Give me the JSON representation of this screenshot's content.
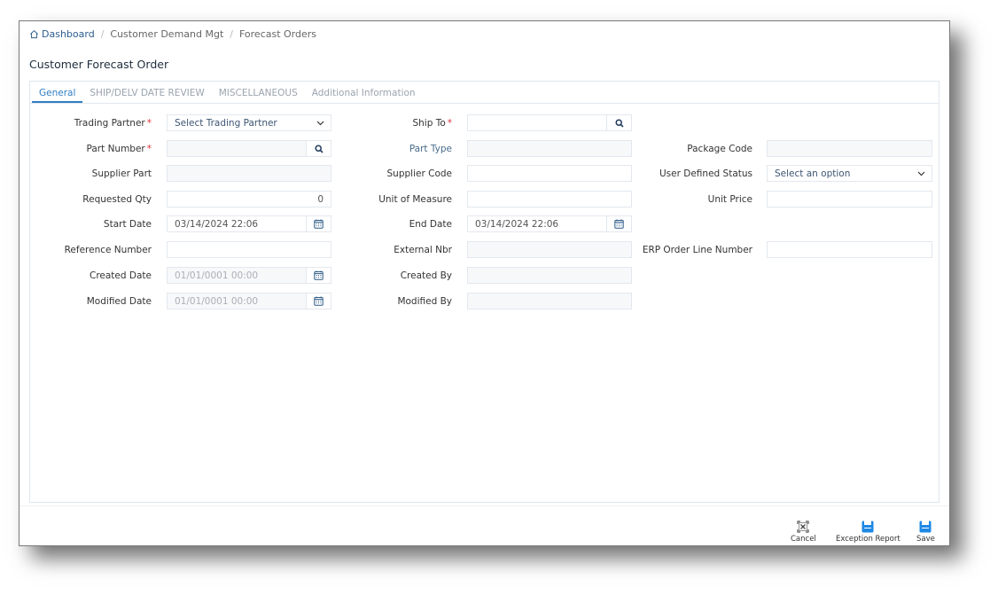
{
  "breadcrumb": {
    "items": [
      "Dashboard",
      "Customer Demand Mgt",
      "Forecast Orders"
    ]
  },
  "page": {
    "title": "Customer Forecast Order"
  },
  "tabs": [
    {
      "label": "General",
      "active": true
    },
    {
      "label": "SHIP/DELV DATE REVIEW",
      "active": false
    },
    {
      "label": "MISCELLANEOUS",
      "active": false
    },
    {
      "label": "Additional Information",
      "active": false
    }
  ],
  "form": {
    "trading_partner": {
      "label": "Trading Partner",
      "required": "*",
      "value": "Select Trading Partner"
    },
    "ship_to": {
      "label": "Ship To",
      "required": "*",
      "value": ""
    },
    "part_number": {
      "label": "Part Number",
      "required": "*",
      "value": ""
    },
    "part_type": {
      "label": "Part Type",
      "value": ""
    },
    "package_code": {
      "label": "Package Code",
      "value": ""
    },
    "supplier_part": {
      "label": "Supplier Part",
      "value": ""
    },
    "supplier_code": {
      "label": "Supplier Code",
      "value": ""
    },
    "user_defined_status": {
      "label": "User Defined Status",
      "value": "Select an option"
    },
    "requested_qty": {
      "label": "Requested Qty",
      "value": "0"
    },
    "unit_of_measure": {
      "label": "Unit of Measure",
      "value": ""
    },
    "unit_price": {
      "label": "Unit Price",
      "value": ""
    },
    "start_date": {
      "label": "Start Date",
      "value": "03/14/2024 22:06"
    },
    "end_date": {
      "label": "End Date",
      "value": "03/14/2024 22:06"
    },
    "reference_number": {
      "label": "Reference Number",
      "value": ""
    },
    "external_nbr": {
      "label": "External Nbr",
      "value": ""
    },
    "erp_order_line_number": {
      "label": "ERP Order Line Number",
      "value": ""
    },
    "created_date": {
      "label": "Created Date",
      "value": "01/01/0001 00:00"
    },
    "created_by": {
      "label": "Created By",
      "value": ""
    },
    "modified_date": {
      "label": "Modified Date",
      "value": "01/01/0001 00:00"
    },
    "modified_by": {
      "label": "Modified By",
      "value": ""
    }
  },
  "actions": {
    "cancel": "Cancel",
    "exception_report": "Exception Report",
    "save": "Save"
  },
  "colors": {
    "accent": "#2f7fc4",
    "required": "#e0303b",
    "save_icon": "#1e88e5"
  }
}
